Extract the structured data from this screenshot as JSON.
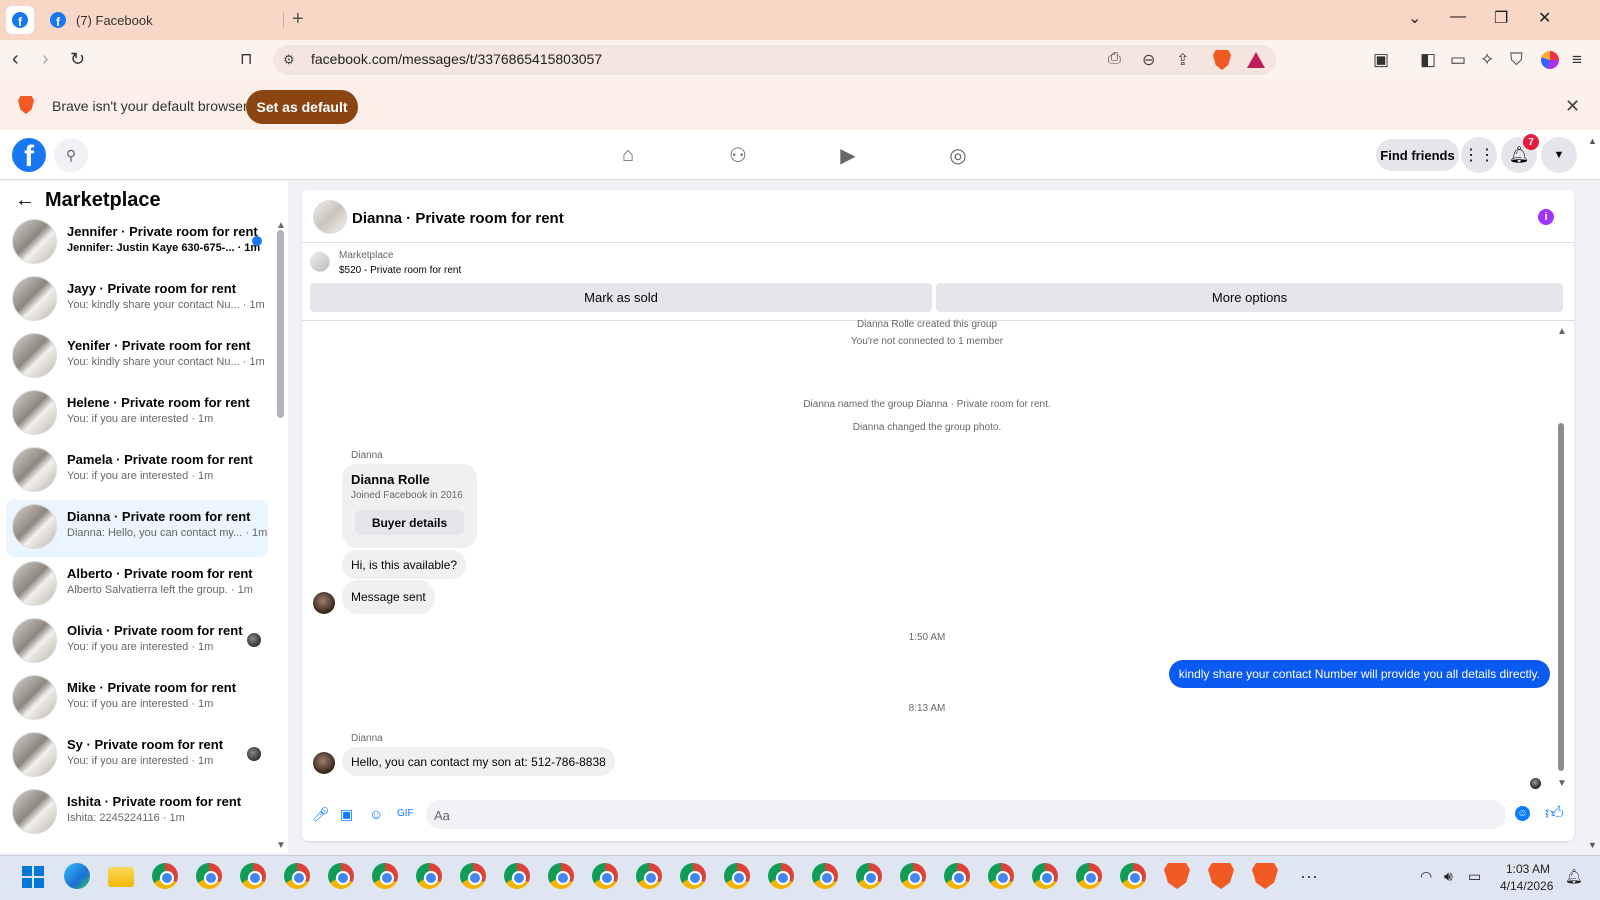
{
  "browser": {
    "tab_title": "(7) Facebook",
    "url": "facebook.com/messages/t/3376865415803057",
    "infobar_text": "Brave isn't your default browser",
    "set_default_label": "Set as default"
  },
  "header": {
    "find_friends_label": "Find friends",
    "notification_count": "7"
  },
  "sidebar": {
    "title": "Marketplace",
    "conversations": [
      {
        "name": "Jennifer · Private room for rent",
        "preview": "Jennifer: Justin Kaye 630-675-... · 1m",
        "unread": true
      },
      {
        "name": "Jayy · Private room for rent",
        "preview": "You: kindly share your contact Nu... · 1m"
      },
      {
        "name": "Yenifer · Private room for rent",
        "preview": "You: kindly share your contact Nu... · 1m"
      },
      {
        "name": "Helene · Private room for rent",
        "preview": "You: if you are interested · 1m"
      },
      {
        "name": "Pamela · Private room for rent",
        "preview": "You: if you are interested · 1m"
      },
      {
        "name": "Dianna · Private room for rent",
        "preview": "Dianna: Hello, you can contact my... · 1m",
        "active": true
      },
      {
        "name": "Alberto · Private room for rent",
        "preview": "Alberto Salvatierra left the group. · 1m"
      },
      {
        "name": "Olivia · Private room for rent",
        "preview": "You: if you are interested · 1m"
      },
      {
        "name": "Mike · Private room for rent",
        "preview": "You: if you are interested · 1m"
      },
      {
        "name": "Sy · Private room for rent",
        "preview": "You: if you are interested · 1m"
      },
      {
        "name": "Ishita · Private room for rent",
        "preview": "Ishita: 2245224116 · 1m"
      }
    ]
  },
  "chat": {
    "title": "Dianna · Private room for rent",
    "listing_label": "Marketplace",
    "listing_price": "$520 - Private room for rent",
    "mark_sold_label": "Mark as sold",
    "more_options_label": "More options",
    "sys_created": "Dianna Rolle created this group",
    "sys_not_connected": "You're not connected to 1 member",
    "sys_named": "Dianna named the group Dianna · Private room for rent.",
    "sys_photo": "Dianna changed the group photo.",
    "sender_1": "Dianna",
    "card_name": "Dianna Rolle",
    "card_joined": "Joined Facebook in 2016",
    "buyer_details_label": "Buyer details",
    "msg_available": "Hi, is this available?",
    "msg_sent": "Message sent",
    "time_1": "1:50 AM",
    "msg_out": "kindly share your contact Number will provide you all details directly.",
    "time_2": "8:13 AM",
    "sender_2": "Dianna",
    "msg_contact": "Hello, you can contact my son at: 512-786-8838",
    "composer_placeholder": "Aa"
  },
  "taskbar": {
    "time": "1:03 AM",
    "date": "4/14/2026"
  }
}
